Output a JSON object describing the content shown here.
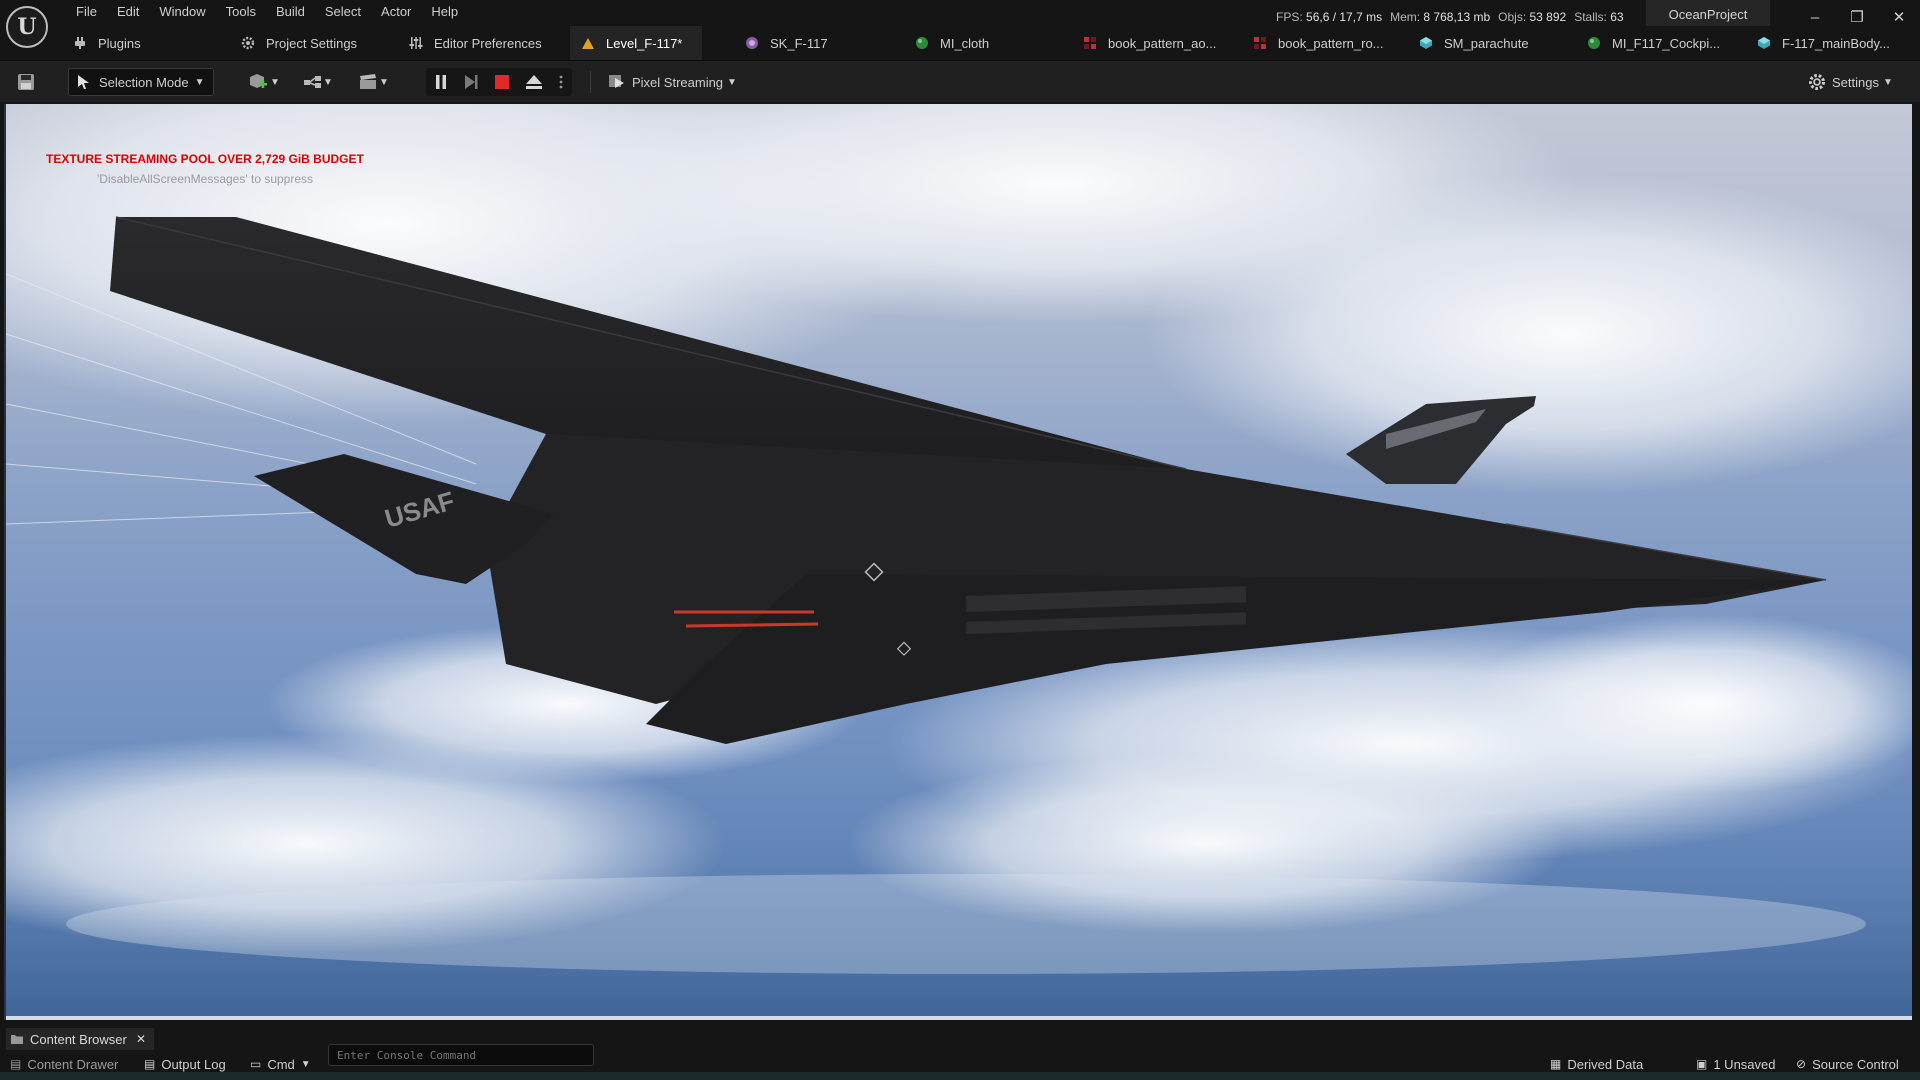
{
  "menu": [
    "File",
    "Edit",
    "Window",
    "Tools",
    "Build",
    "Select",
    "Actor",
    "Help"
  ],
  "stats": {
    "fps_label": "FPS:",
    "fps_value": "56,6",
    "ms_value": "/ 17,7 ms",
    "mem_label": "Mem:",
    "mem_value": "8 768,13 mb",
    "objs_label": "Objs:",
    "objs_value": "53 892",
    "stalls_label": "Stalls:",
    "stalls_value": "63"
  },
  "project_name": "OceanProject",
  "window_controls": {
    "minimize": "–",
    "restore": "❐",
    "close": "✕"
  },
  "tabs": [
    {
      "label": "Plugins",
      "icon": "plug-icon"
    },
    {
      "label": "Project Settings",
      "icon": "gear-icon"
    },
    {
      "label": "Editor Preferences",
      "icon": "sliders-icon"
    },
    {
      "label": "Level_F-117*",
      "icon": "level-icon"
    },
    {
      "label": "SK_F-117",
      "icon": "skeletal-mesh-icon"
    },
    {
      "label": "MI_cloth",
      "icon": "material-instance-icon"
    },
    {
      "label": "book_pattern_ao...",
      "icon": "texture-icon"
    },
    {
      "label": "book_pattern_ro...",
      "icon": "texture-icon"
    },
    {
      "label": "SM_parachute",
      "icon": "static-mesh-icon"
    },
    {
      "label": "MI_F117_Cockpi...",
      "icon": "material-instance-icon"
    },
    {
      "label": "F-117_mainBody...",
      "icon": "static-mesh-icon"
    }
  ],
  "toolbar": {
    "mode_label": "Selection Mode",
    "stream_label": "Pixel Streaming",
    "settings_label": "Settings"
  },
  "viewport": {
    "warning": "TEXTURE STREAMING POOL OVER 2,729 GiB BUDGET",
    "suppress_hint": "'DisableAllScreenMessages' to suppress",
    "tail_marking": "USAF"
  },
  "bottom": {
    "content_browser_tab": "Content Browser",
    "content_drawer": "Content Drawer",
    "output_log": "Output Log",
    "cmd_label": "Cmd",
    "console_placeholder": "Enter Console Command",
    "derived_data": "Derived Data",
    "unsaved": "1 Unsaved",
    "source_control": "Source Control"
  },
  "colors": {
    "warning": "#e00000",
    "accent_level_tab": "#e0a020",
    "panel_bg": "#151515",
    "toolbar_bg": "#202020"
  }
}
